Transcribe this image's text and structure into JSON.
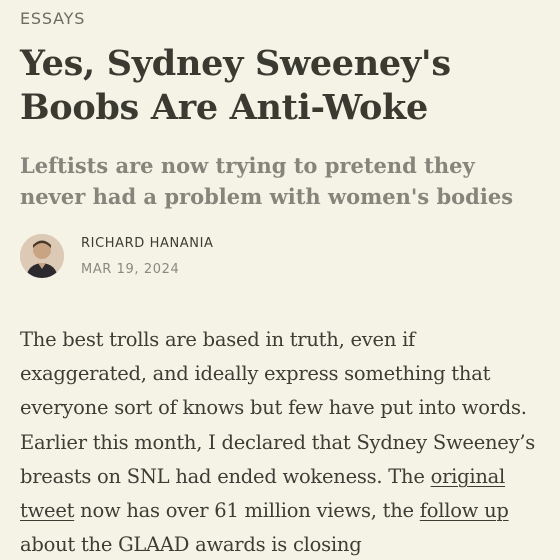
{
  "post": {
    "section": "ESSAYS",
    "title": "Yes, Sydney Sweeney's Boobs Are Anti-Woke",
    "subtitle": "Leftists are now trying to pretend they never had a problem with women's bodies",
    "author": "RICHARD HANANIA",
    "date": "MAR 19, 2024",
    "avatar_icon": "author-avatar"
  },
  "body": {
    "text_1": "The best trolls are based in truth, even if exaggerated, and ideally express something that everyone sort of knows but few have put into words. Earlier this month, I declared that Sydney Sweeney’s breasts on SNL had ended wokeness. The ",
    "link_1": "original tweet",
    "text_2": " now has over 61 million views, the ",
    "link_2": "follow up",
    "text_3": " about the GLAAD awards is closing"
  },
  "colors": {
    "background": "#f5f3e6",
    "text": "#3d3d35",
    "muted": "#86857c"
  }
}
